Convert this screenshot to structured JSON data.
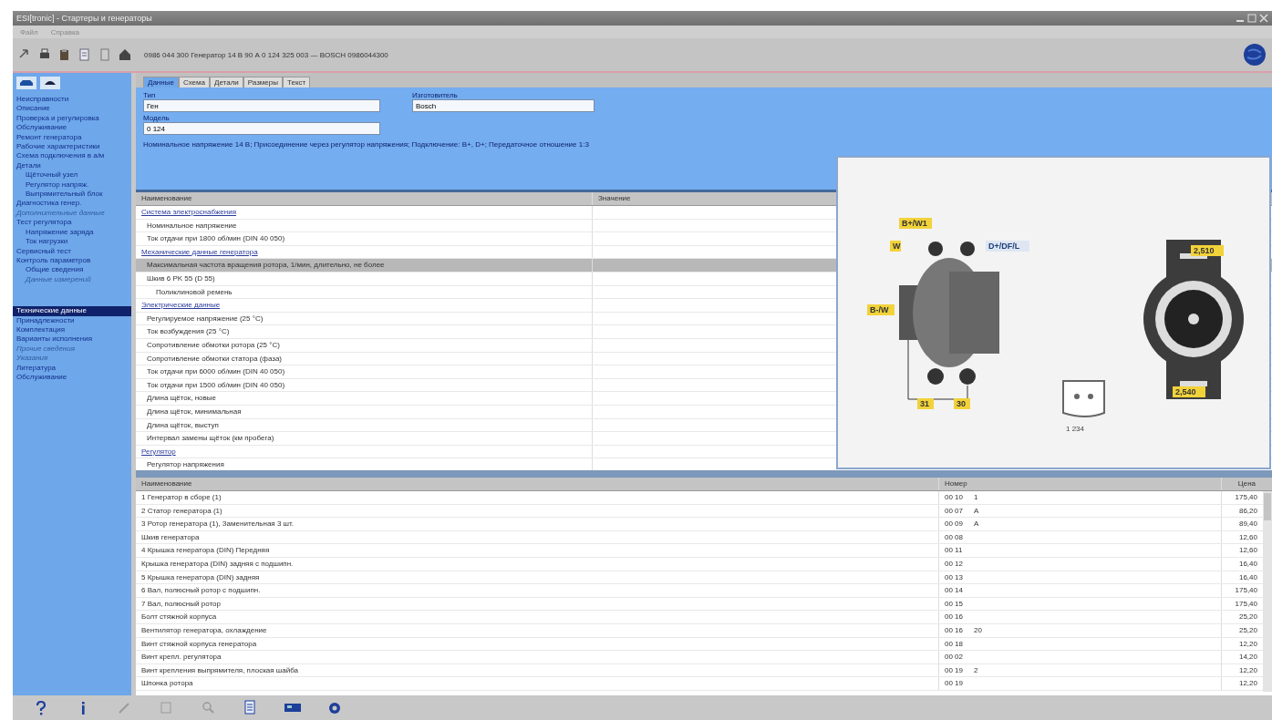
{
  "window": {
    "title": "ESI[tronic] - Стартеры и генераторы"
  },
  "menu": [
    "Файл",
    "Справка"
  ],
  "toolbar": {
    "path": "0986 044 300  Генератор 14 В 90 А  0 124 325 003  —  BOSCH  0986044300"
  },
  "sidebar": {
    "items": [
      {
        "label": "Неисправности",
        "selected": false,
        "disabled": false
      },
      {
        "label": "Описание",
        "selected": false,
        "disabled": false
      },
      {
        "label": "Проверка и регулировка",
        "selected": false,
        "disabled": false
      },
      {
        "label": "Обслуживание",
        "selected": false,
        "disabled": false
      },
      {
        "label": "Ремонт генератора",
        "selected": false,
        "disabled": false
      },
      {
        "label": "Рабочие характеристики",
        "selected": false,
        "disabled": false
      },
      {
        "label": "Схема подключения в а/м",
        "selected": false,
        "disabled": false
      },
      {
        "label": "Детали",
        "selected": false,
        "disabled": false,
        "children": [
          {
            "label": "Щёточный узел",
            "selected": false,
            "disabled": false
          },
          {
            "label": "Регулятор напряж.",
            "selected": false,
            "disabled": false
          },
          {
            "label": "Выпрямительный блок",
            "selected": false,
            "disabled": false
          }
        ]
      },
      {
        "label": "Диагностика генер.",
        "selected": false,
        "disabled": false
      },
      {
        "label": "Дополнительные данные",
        "selected": false,
        "disabled": true
      },
      {
        "label": "Тест регулятора",
        "selected": false,
        "disabled": false,
        "children": [
          {
            "label": "Напряжение заряда",
            "selected": false,
            "disabled": false
          },
          {
            "label": "Ток нагрузки",
            "selected": false,
            "disabled": false
          }
        ]
      },
      {
        "label": "Сервисный тест",
        "selected": false,
        "disabled": false
      },
      {
        "label": "Контроль параметров",
        "selected": false,
        "disabled": false,
        "children": [
          {
            "label": "Общие сведения",
            "selected": false,
            "disabled": false
          },
          {
            "label": "Данные измерений",
            "selected": false,
            "disabled": true
          }
        ]
      },
      {
        "label": "Технические данные",
        "selected": true,
        "disabled": false
      },
      {
        "label": "Принадлежности",
        "selected": false,
        "disabled": false
      },
      {
        "label": "Комплектация",
        "selected": false,
        "disabled": false
      },
      {
        "label": "Варианты исполнения",
        "selected": false,
        "disabled": false
      },
      {
        "label": "Прочие сведения",
        "selected": false,
        "disabled": true
      },
      {
        "label": "Указания",
        "selected": false,
        "disabled": true
      },
      {
        "label": "Литература",
        "selected": false,
        "disabled": false
      },
      {
        "label": "Обслуживание",
        "selected": false,
        "disabled": false
      }
    ]
  },
  "tabs": [
    {
      "label": "Данные",
      "selected": true
    },
    {
      "label": "Схема",
      "selected": false
    },
    {
      "label": "Детали",
      "selected": false
    },
    {
      "label": "Размеры",
      "selected": false
    },
    {
      "label": "Текст",
      "selected": false
    }
  ],
  "form": {
    "fields": [
      {
        "label": "Тип",
        "value": "Ген"
      },
      {
        "label": "Изготовитель",
        "value": "Bosch"
      },
      {
        "label": "Модель",
        "value": "0 124"
      }
    ],
    "note": "Номинальное напряжение 14 В; Присоединение через регулятор напряжения; Подключение: В+, D+; Передаточное отношение 1:3"
  },
  "spec_table": {
    "columns": [
      "Наименование",
      "Значение"
    ],
    "rows": [
      {
        "kind": "group",
        "label": "Система электроснабжения",
        "children": [
          {
            "label": "Номинальное напряжение",
            "selected": false
          },
          {
            "label": "Ток отдачи при 1800 об/мин (DIN 40 050)",
            "selected": false
          }
        ]
      },
      {
        "kind": "group",
        "label": "Механические данные генератора",
        "children": [
          {
            "label": "Максимальная частота вращения ротора, 1/мин, длительно, не более",
            "selected": true
          },
          {
            "label": "Шкив 6 PK 55 (D 55)",
            "selected": false,
            "children": [
              {
                "label": "Поликлиновой ремень",
                "selected": false
              }
            ]
          }
        ]
      },
      {
        "kind": "group",
        "label": "Электрические данные",
        "children": [
          {
            "label": "Регулируемое напряжение (25 °С)",
            "selected": false
          },
          {
            "label": "Ток возбуждения (25 °С)",
            "selected": false
          },
          {
            "label": "Сопротивление обмотки ротора (25 °С)",
            "selected": false
          },
          {
            "label": "Сопротивление обмотки статора (фаза)",
            "selected": false
          },
          {
            "label": "Ток отдачи при 6000 об/мин (DIN 40 050)",
            "selected": false
          },
          {
            "label": "Ток отдачи при 1500 об/мин (DIN 40 050)",
            "selected": false
          },
          {
            "label": "Длина щёток, новые",
            "selected": false
          },
          {
            "label": "Длина щёток, минимальная",
            "selected": false
          },
          {
            "label": "Длина щёток, выступ",
            "selected": false
          },
          {
            "label": "Интервал замены щёток (км пробега)",
            "selected": false
          }
        ]
      },
      {
        "kind": "group",
        "label": "Регулятор",
        "children": [
          {
            "label": "Регулятор напряжения",
            "selected": false
          }
        ]
      }
    ]
  },
  "diagram": {
    "labels": [
      "B+/W1",
      "W",
      "D+/DF/L",
      "B-/W",
      "31",
      "30",
      "2,510",
      "2,540"
    ],
    "connector_label": "1 234"
  },
  "parts_table": {
    "columns": [
      "Наименование",
      "Номер",
      "Цена"
    ],
    "rows": [
      {
        "name": "1  Генератор в сборе (1)",
        "code": "00 10",
        "mark": "1",
        "price": "175,40"
      },
      {
        "name": "2  Статор генератора (1)",
        "code": "00 07",
        "mark": "A",
        "price": "86,20"
      },
      {
        "name": "3  Ротор генератора (1), Заменительная 3 шт.",
        "code": "00 09",
        "mark": "A",
        "price": "89,40"
      },
      {
        "name": "Шкив генератора",
        "code": "00 08",
        "mark": "",
        "price": "12,60"
      },
      {
        "name": "4  Крышка генератора (DIN) Передняя",
        "code": "00 11",
        "mark": "",
        "price": "12,60"
      },
      {
        "name": "Крышка генератора (DIN) задняя с подшипн.",
        "code": "00 12",
        "mark": "",
        "price": "16,40"
      },
      {
        "name": "5  Крышка генератора (DIN) задняя",
        "code": "00 13",
        "mark": "",
        "price": "16,40"
      },
      {
        "name": "6  Вал, полюсный ротор с подшипн.",
        "code": "00 14",
        "mark": "",
        "price": "175,40"
      },
      {
        "name": "7  Вал, полюсный ротор",
        "code": "00 15",
        "mark": "",
        "price": "175,40"
      },
      {
        "name": "Болт стяжной корпуса",
        "code": "00 16",
        "mark": "",
        "price": "25,20"
      },
      {
        "name": "Вентилятор генератора, охлаждение",
        "code": "00 16",
        "mark": "20",
        "price": "25,20"
      },
      {
        "name": "Винт стяжной корпуса генератора",
        "code": "00 18",
        "mark": "",
        "price": "12,20"
      },
      {
        "name": "Винт крепл. регулятора",
        "code": "00 02",
        "mark": "",
        "price": "14,20"
      },
      {
        "name": "Винт крепления выпрямителя, плоская шайба",
        "code": "00 19",
        "mark": "2",
        "price": "12,20"
      },
      {
        "name": "Шпонка ротора",
        "code": "00 19",
        "mark": "",
        "price": "12,20"
      }
    ]
  }
}
